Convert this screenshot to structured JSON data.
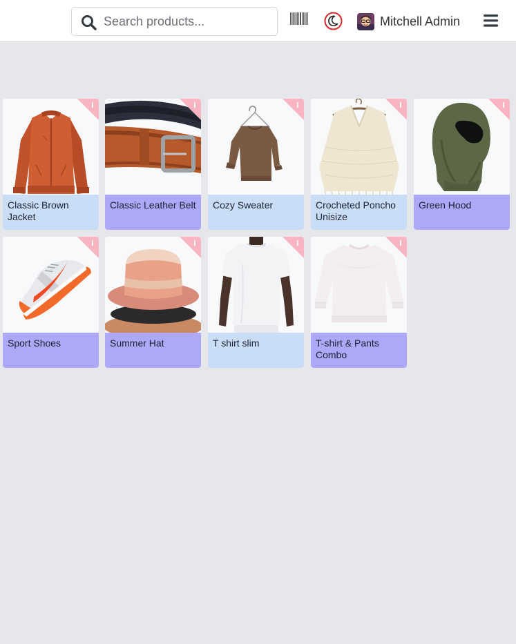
{
  "header": {
    "search": {
      "placeholder": "Search products...",
      "value": ""
    },
    "barcode_icon": "barcode-icon",
    "theme_icon": "moon-icon",
    "user": {
      "name": "Mitchell Admin",
      "avatar_icon": "avatar-icon"
    },
    "menu_icon": "hamburger-menu-icon"
  },
  "colors": {
    "background": "#e6e7eb",
    "card_blue": "#c9ddf7",
    "card_purple": "#ada8f8",
    "info_flag": "#f8b5c1",
    "theme_ring": "#d62828"
  },
  "products": [
    {
      "name": "Classic Brown Jacket",
      "color": "blue",
      "image": "jacket"
    },
    {
      "name": "Classic Leather Belt",
      "color": "purple",
      "image": "belt"
    },
    {
      "name": "Cozy Sweater",
      "color": "blue",
      "image": "sweater"
    },
    {
      "name": "Crocheted Poncho Unisize",
      "color": "blue",
      "image": "poncho"
    },
    {
      "name": "Green Hood",
      "color": "purple",
      "image": "hood"
    },
    {
      "name": "Sport Shoes",
      "color": "purple",
      "image": "shoe"
    },
    {
      "name": "Summer Hat",
      "color": "purple",
      "image": "hat"
    },
    {
      "name": "T shirt slim",
      "color": "blue",
      "image": "tshirt"
    },
    {
      "name": "T-shirt & Pants Combo",
      "color": "purple",
      "image": "sweatshirt"
    }
  ],
  "info_badge_glyph": "i"
}
